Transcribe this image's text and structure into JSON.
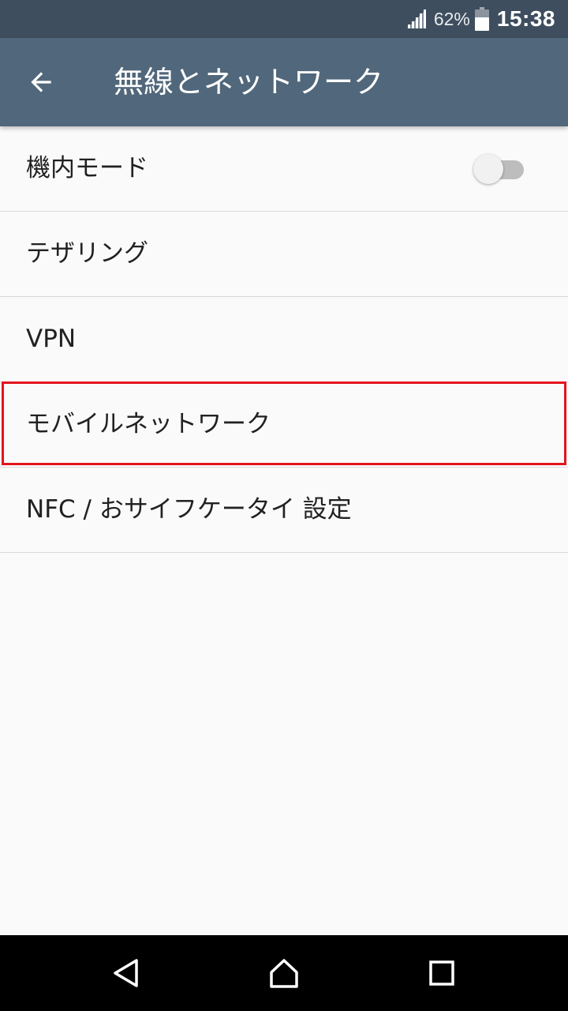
{
  "status_bar": {
    "battery_percent": "62%",
    "time": "15:38",
    "icons": [
      "signal-icon",
      "battery-icon"
    ]
  },
  "app_bar": {
    "title": "無線とネットワーク",
    "back_icon": "arrow-back-icon",
    "background_color": "#51677b"
  },
  "settings": {
    "items": [
      {
        "label": "機内モード",
        "toggle": {
          "state": "off"
        }
      },
      {
        "label": "テザリング"
      },
      {
        "label": "VPN"
      },
      {
        "label": "モバイルネットワーク",
        "highlighted": true
      },
      {
        "label": "NFC / おサイフケータイ 設定"
      }
    ]
  },
  "nav_bar": {
    "icons": [
      "nav-back-icon",
      "nav-home-icon",
      "nav-recents-icon"
    ]
  },
  "colors": {
    "status_bar": "#3e4e5e",
    "highlight": "#e3141e",
    "list_background": "#fafafa"
  }
}
